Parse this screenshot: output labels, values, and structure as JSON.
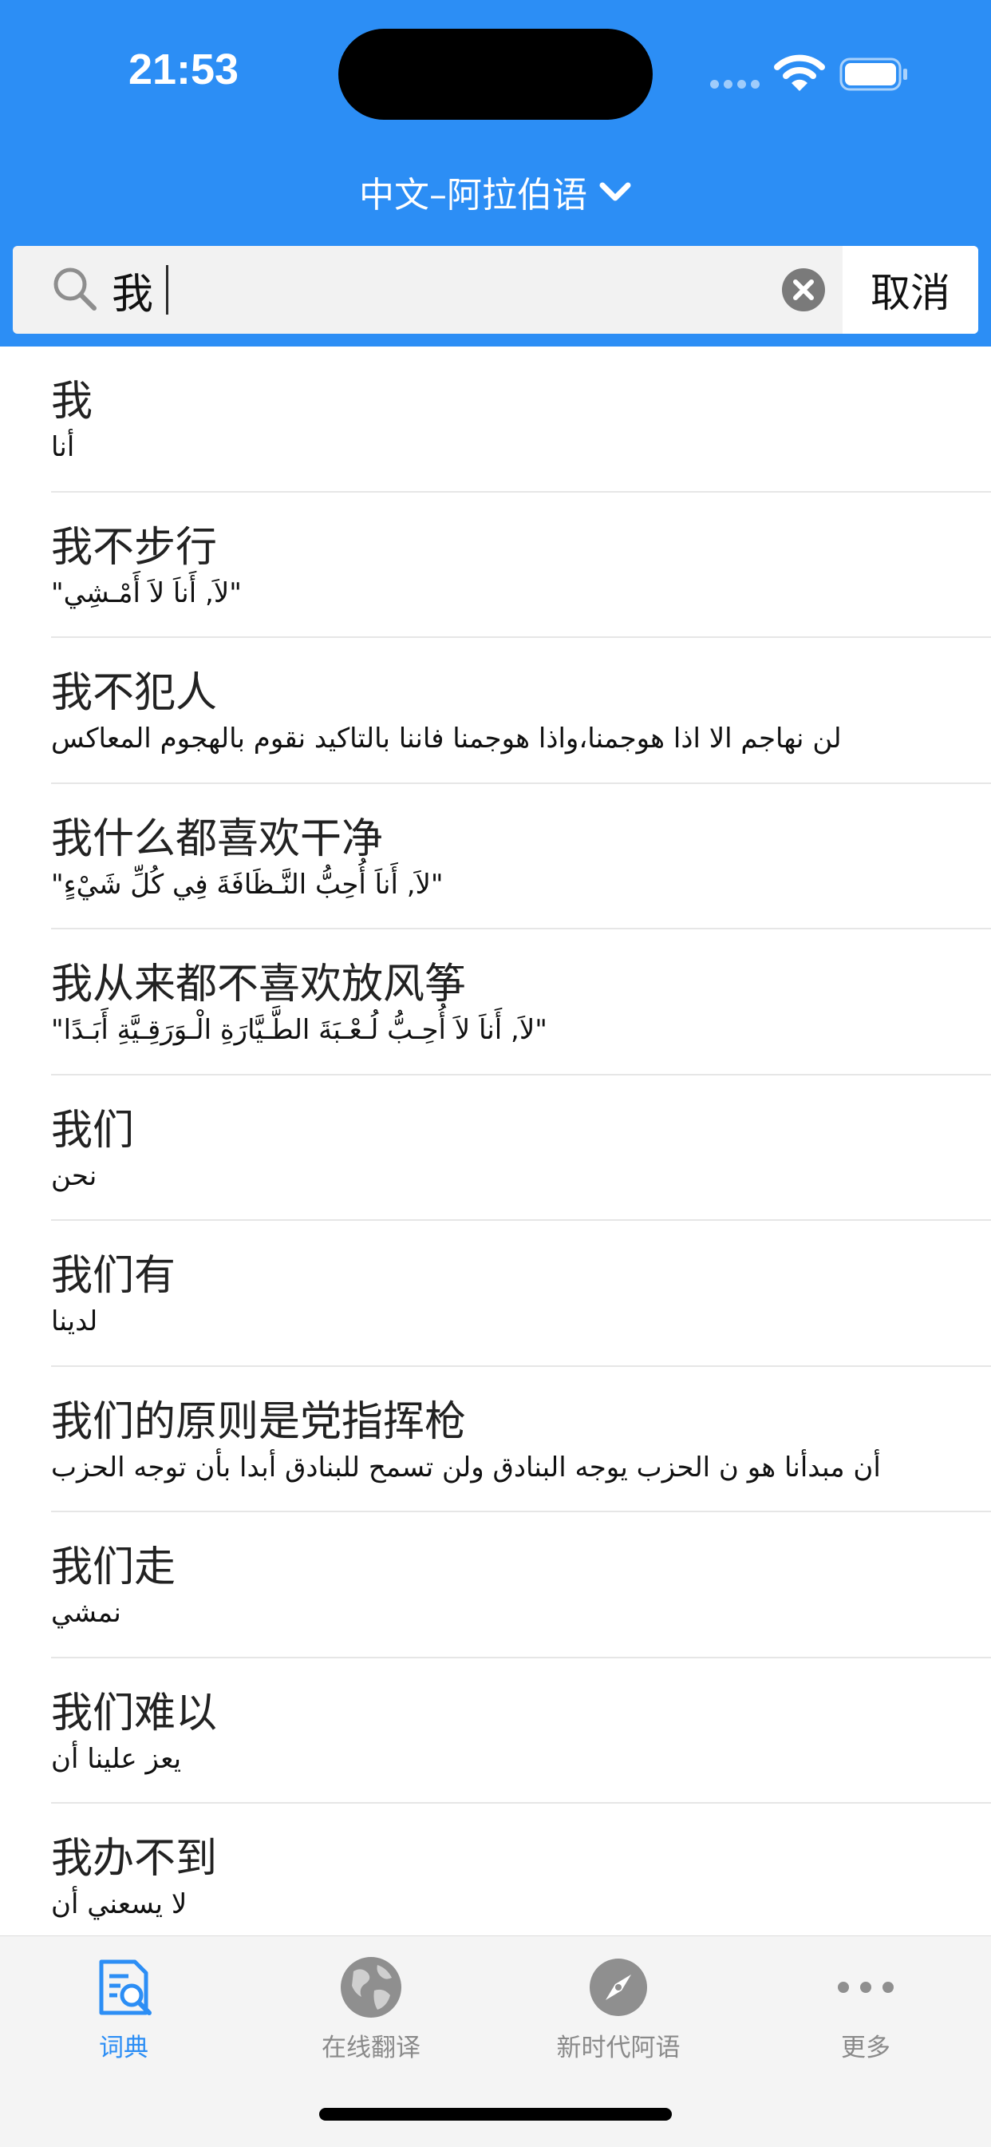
{
  "status_bar": {
    "time": "21:53"
  },
  "language_selector": {
    "label": "中文–阿拉伯语"
  },
  "search": {
    "value": "我",
    "cancel_label": "取消"
  },
  "results": [
    {
      "chinese": "我",
      "arabic": "أنا"
    },
    {
      "chinese": "我不步行",
      "arabic": "\"لاَ, أَناَ لاَ أَمْـشِي\""
    },
    {
      "chinese": "我不犯人",
      "arabic": "لن نهاجم الا اذا هوجمنا،واذا هوجمنا فاننا بالتاكيد نقوم بالهجوم المعاكس"
    },
    {
      "chinese": "我什么都喜欢干净",
      "arabic": "\"لاَ, أَناَ أُحِبُّ النَّـظَافَةَ فِي كُلِّ شَيْءٍ\""
    },
    {
      "chinese": "我从来都不喜欢放风筝",
      "arabic": "\"لاَ, أَناَ لاَ أُحِـبُّ لُـعْـبَةَ الطَّـيَّارَةِ الْـوَرَقِـيَّةِ أَبَـدًا\""
    },
    {
      "chinese": "我们",
      "arabic": "نحن"
    },
    {
      "chinese": "我们有",
      "arabic": "لدينا"
    },
    {
      "chinese": "我们的原则是党指挥枪",
      "arabic": "أن مبدأنا هو ن الحزب يوجه البنادق ولن تسمح للبنادق أبدا بأن توجه الحزب"
    },
    {
      "chinese": "我们走",
      "arabic": "نمشي"
    },
    {
      "chinese": "我们难以",
      "arabic": "يعز علينا  أن"
    },
    {
      "chinese": "我办不到",
      "arabic": "لا يسعني أن"
    }
  ],
  "tabs": [
    {
      "label": "词典",
      "icon": "dictionary-icon",
      "active": true
    },
    {
      "label": "在线翻译",
      "icon": "globe-icon",
      "active": false
    },
    {
      "label": "新时代阿语",
      "icon": "compass-icon",
      "active": false
    },
    {
      "label": "更多",
      "icon": "more-icon",
      "active": false
    }
  ],
  "colors": {
    "accent": "#2c8ef5",
    "tab_inactive": "#8a8a8a",
    "tab_bar_bg": "#f4f4f4"
  }
}
